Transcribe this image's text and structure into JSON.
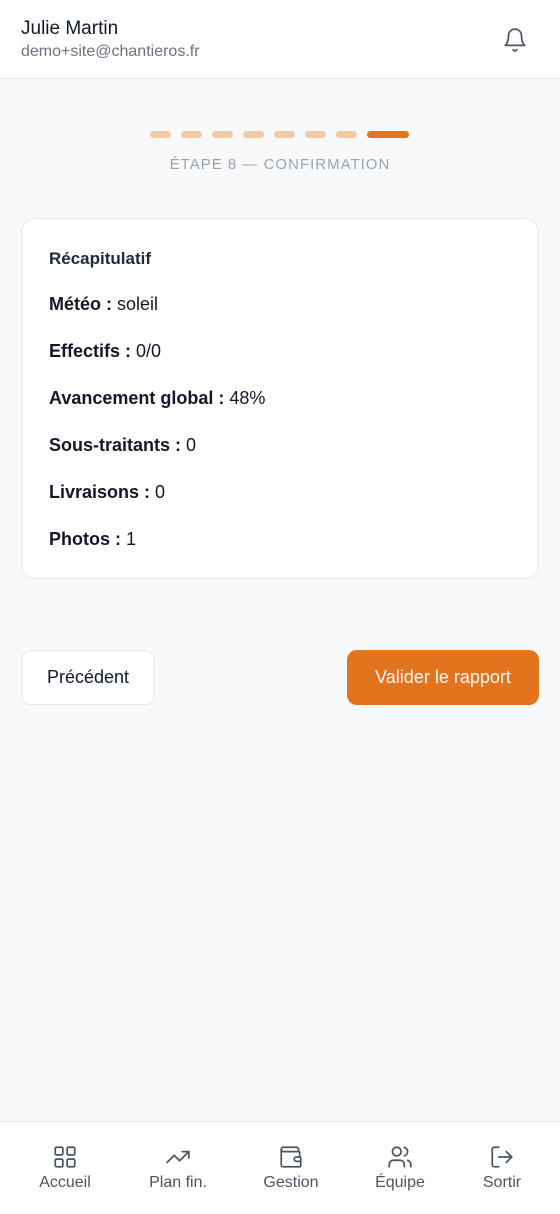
{
  "header": {
    "user_name": "Julie Martin",
    "user_email": "demo+site@chantieros.fr",
    "notification_icon": "bell-icon"
  },
  "stepper": {
    "total_steps": 8,
    "current_step": 8,
    "label": "ÉTAPE 8 — CONFIRMATION",
    "colors": {
      "active": "#e4731e",
      "inactive": "#f3c9a6"
    }
  },
  "summary": {
    "title": "Récapitulatif",
    "rows": [
      {
        "key": "Météo :",
        "value": "soleil"
      },
      {
        "key": "Effectifs :",
        "value": "0/0"
      },
      {
        "key": "Avancement global :",
        "value": "48%"
      },
      {
        "key": "Sous-traitants :",
        "value": "0"
      },
      {
        "key": "Livraisons :",
        "value": "0"
      },
      {
        "key": "Photos :",
        "value": "1"
      }
    ]
  },
  "actions": {
    "previous_label": "Précédent",
    "validate_label": "Valider le rapport",
    "accent_color": "#e4731e"
  },
  "bottom_nav": {
    "items": [
      {
        "label": "Accueil",
        "icon": "grid-icon"
      },
      {
        "label": "Plan fin.",
        "icon": "trending-up-icon"
      },
      {
        "label": "Gestion",
        "icon": "wallet-icon"
      },
      {
        "label": "Équipe",
        "icon": "users-icon"
      },
      {
        "label": "Sortir",
        "icon": "logout-icon"
      }
    ]
  }
}
